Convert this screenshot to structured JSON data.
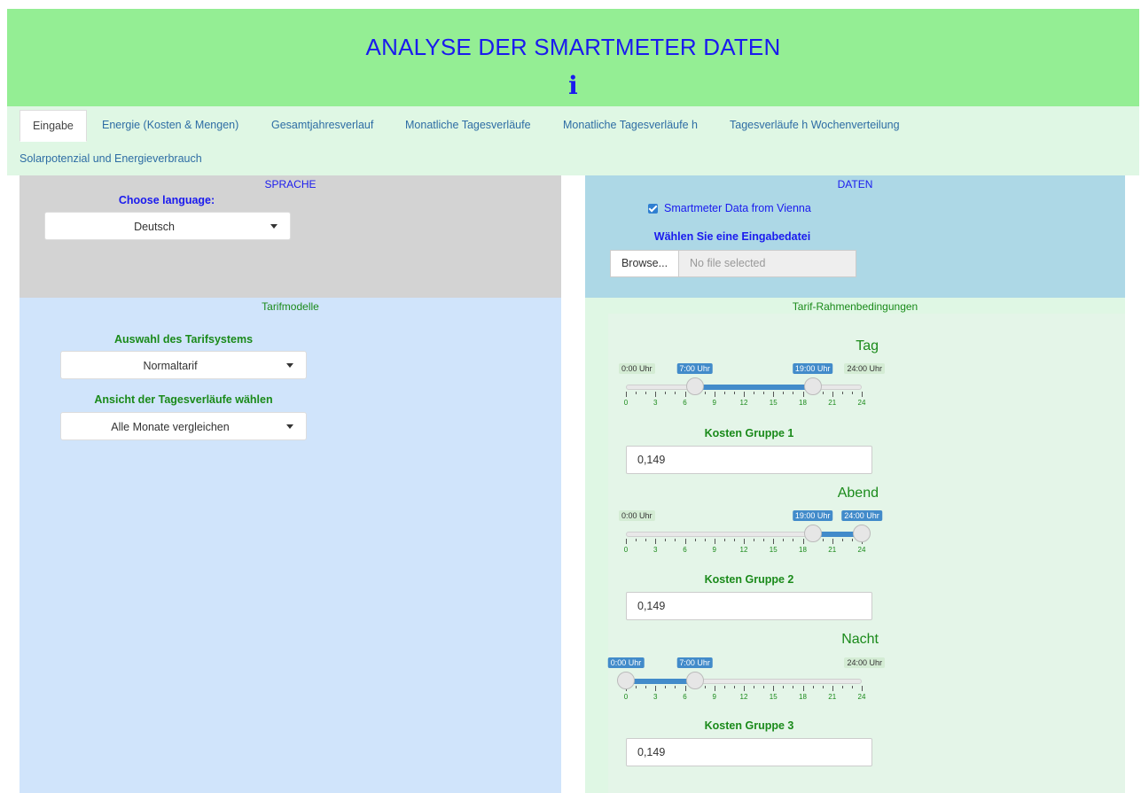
{
  "header": {
    "title": "ANALYSE DER SMARTMETER DATEN",
    "info_glyph": "i"
  },
  "tabs": [
    {
      "label": "Eingabe",
      "active": true
    },
    {
      "label": "Energie (Kosten & Mengen)"
    },
    {
      "label": "Gesamtjahresverlauf"
    },
    {
      "label": "Monatliche Tagesverläufe"
    },
    {
      "label": "Monatliche Tagesverläufe h"
    },
    {
      "label": "Tagesverläufe h Wochenverteilung"
    },
    {
      "label": "Solarpotenzial und Energieverbrauch"
    }
  ],
  "sprache": {
    "heading": "SPRACHE",
    "choose_label": "Choose language:",
    "language_value": "Deutsch"
  },
  "daten": {
    "heading": "DATEN",
    "checkbox_label": "Smartmeter Data from Vienna",
    "checkbox_checked": true,
    "file_label": "Wählen Sie eine Eingabedatei",
    "browse_label": "Browse...",
    "file_placeholder": "No file selected"
  },
  "tarifmodelle": {
    "heading": "Tarifmodelle",
    "system_label": "Auswahl des Tarifsystems",
    "system_value": "Normaltarif",
    "view_label": "Ansicht der Tagesverläufe wählen",
    "view_value": "Alle Monate vergleichen"
  },
  "rahmen": {
    "heading": "Tarif-Rahmenbedingungen",
    "groups": [
      {
        "title": "Tag",
        "min_label": "0:00 Uhr",
        "max_label": "24:00 Uhr",
        "from": 7,
        "to": 19,
        "from_label": "7:00 Uhr",
        "to_label": "19:00 Uhr",
        "cost_label": "Kosten Gruppe 1",
        "cost_value": "0,149"
      },
      {
        "title": "Abend",
        "min_label": "0:00 Uhr",
        "max_label": "24:00 Uhr",
        "from": 19,
        "to": 24,
        "from_label": "19:00 Uhr",
        "to_label": "24:00 Uhr",
        "cost_label": "Kosten Gruppe 2",
        "cost_value": "0,149"
      },
      {
        "title": "Nacht",
        "min_label": "0:00 Uhr",
        "max_label": "24:00 Uhr",
        "from": 0,
        "to": 7,
        "from_label": "0:00 Uhr",
        "to_label": "7:00 Uhr",
        "cost_label": "Kosten Gruppe 3",
        "cost_value": "0,149"
      }
    ],
    "tick_labels": [
      "0",
      "3",
      "6",
      "9",
      "12",
      "15",
      "18",
      "21",
      "24"
    ]
  },
  "colors": {
    "header_bg": "#94ee94",
    "title": "#1a1aee",
    "accent": "#428bca",
    "green_text": "#1a8a1a"
  }
}
